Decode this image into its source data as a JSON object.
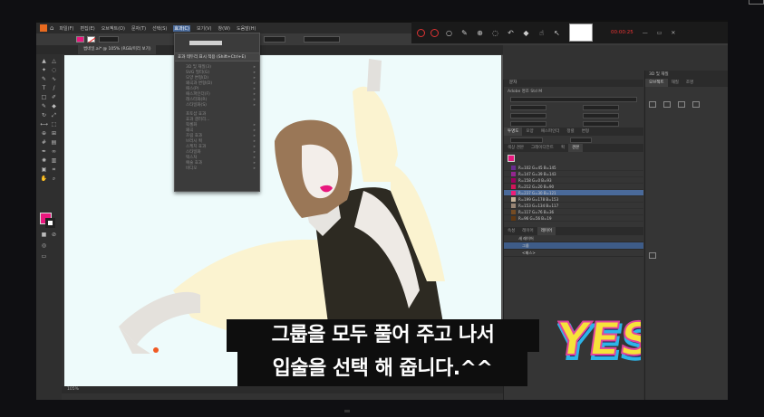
{
  "app": {
    "menus": [
      "파일(F)",
      "편집(E)",
      "오브젝트(O)",
      "문자(T)",
      "선택(S)",
      "효과(C)",
      "보기(V)",
      "창(W)",
      "도움말(H)"
    ],
    "active_menu_index": 5,
    "doc_tab": "썸네일.ai* @ 105% (RGB/미리 보기)",
    "zoom_status": "105%"
  },
  "effect_menu": {
    "selected": "효과 테두리 표시 적용 (Shift+Ctrl+E)",
    "items": [
      "3D 및 재질(3)",
      "SVG 필터(G)",
      "모양 변형(D)",
      "왜곡과 변형(D)",
      "패스(P)",
      "패스파인더(F)",
      "래스터화(R)",
      "스타일화(S)",
      "",
      "포토샵 효과",
      "효과 갤러리...",
      "픽셀화",
      "왜곡",
      "흐림 효과",
      "브러시 획",
      "스케치 효과",
      "스타일화",
      "텍스처",
      "예술 효과",
      "비디오",
      "포토샵 효과"
    ]
  },
  "panels": {
    "character_title": "문자",
    "font_name": "Adobe 명조 Std M",
    "char_tabs": [
      "투명도",
      "모양",
      "패스파인더",
      "정렬",
      "변형"
    ],
    "swatch_tabs": [
      "색상 견본",
      "그레이디언트",
      "획",
      "견본"
    ],
    "swatches": [
      {
        "label": "R=102 G=45 B=145",
        "color": "#6a2d91"
      },
      {
        "label": "R=147 G=39 B=143",
        "color": "#93278f"
      },
      {
        "label": "R=158 G=0 B=93",
        "color": "#9e005d"
      },
      {
        "label": "R=212 G=20 B=90",
        "color": "#d4145a"
      },
      {
        "label": "R=237 G=30 B=121",
        "color": "#ed1e79"
      },
      {
        "label": "R=199 G=178 B=153",
        "color": "#c7b299"
      },
      {
        "label": "R=153 G=134 B=117",
        "color": "#998675"
      },
      {
        "label": "R=117 G=76 B=36",
        "color": "#754c24"
      },
      {
        "label": "R=96 G=56 B=19",
        "color": "#603813"
      }
    ],
    "selected_swatch_index": 4,
    "layers_tabs": [
      "속성",
      "레이어",
      "레이어"
    ],
    "layers": [
      "새 레이어",
      "그룹",
      "<패스>"
    ],
    "props_title": "3D 및 재질",
    "props_tabs": [
      "오브젝트",
      "재질",
      "조명"
    ]
  },
  "subtitle": {
    "line1": "그룹을 모두 풀어 주고 나서",
    "line2": "입술을 선택 해 줍니다.^^"
  },
  "sticker": {
    "text": "YES"
  },
  "floatbar": {
    "red_text": "00:00:25"
  }
}
